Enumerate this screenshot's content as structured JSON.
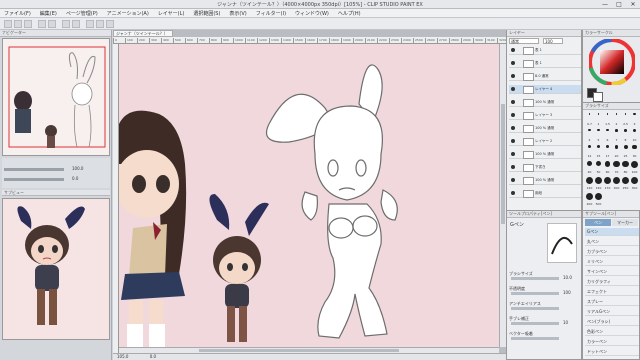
{
  "window": {
    "title": "ジャンナ（ツインテール？）（4000×4000px 350dpi）[105%] - CLIP STUDIO PAINT EX",
    "controls": [
      "—",
      "□",
      "✕"
    ]
  },
  "menu": [
    "ファイル(F)",
    "編集(E)",
    "ページ管理(P)",
    "アニメーション(A)",
    "レイヤー(L)",
    "選択範囲(S)",
    "表示(V)",
    "フィルター(I)",
    "ウィンドウ(W)",
    "ヘルプ(H)"
  ],
  "left_panel": {
    "navigator_title": "ナビゲーター",
    "subview_title": "サブビュー",
    "zoom_value": "100.0",
    "angle_value": "0.0"
  },
  "canvas": {
    "tab_label": "ジャンナ（ツインテール？）",
    "ruler_ticks": [
      "0",
      "100",
      "200",
      "300",
      "400",
      "500",
      "600",
      "700",
      "800",
      "900",
      "1000",
      "1100",
      "1200",
      "1300",
      "1400",
      "1500",
      "1600",
      "1700",
      "1800",
      "1900",
      "2000",
      "2100",
      "2200",
      "2300",
      "2400",
      "2500",
      "2600",
      "2700",
      "2800",
      "2900",
      "3000",
      "3100",
      "3200"
    ],
    "status_zoom": "105.0",
    "status_angle": "0.0"
  },
  "layer_panel": {
    "title": "レイヤー",
    "blend_mode": "通常",
    "opacity": "100",
    "layers": [
      {
        "name": "表 1"
      },
      {
        "name": "表 1"
      },
      {
        "name": "8.0 通常"
      },
      {
        "name": "レイヤー 4"
      },
      {
        "name": "100 % 通常"
      },
      {
        "name": "レイヤー 3"
      },
      {
        "name": "100 % 通常"
      },
      {
        "name": "レイヤー 2"
      },
      {
        "name": "100 % 通常"
      },
      {
        "name": "下書き"
      },
      {
        "name": "100 % 通常"
      },
      {
        "name": "用紙"
      }
    ]
  },
  "color_panel": {
    "title": "カラーサークル",
    "hue_hex": "#d22828"
  },
  "brush_panel": {
    "title": "ブラシサイズ",
    "sizes": [
      "0.7",
      "1",
      "1.5",
      "2",
      "2.5",
      "3",
      "4",
      "5",
      "6",
      "7",
      "8",
      "10",
      "12",
      "15",
      "17",
      "20",
      "25",
      "30",
      "40",
      "50",
      "60",
      "70",
      "80",
      "100",
      "120",
      "150",
      "170",
      "200",
      "250",
      "300",
      "400",
      "500"
    ]
  },
  "tool_property": {
    "title": "ツールプロパティ[ペン]",
    "tool_name": "Gペン",
    "rows": [
      {
        "label": "ブラシサイズ",
        "value": "10.0"
      },
      {
        "label": "不透明度",
        "value": "100"
      },
      {
        "label": "アンチエイリアス",
        "value": ""
      },
      {
        "label": "手ブレ補正",
        "value": "10"
      },
      {
        "label": "ベクター吸着",
        "value": ""
      }
    ]
  },
  "sub_tool": {
    "title": "サブツール[ペン]",
    "tabs": [
      "ペン",
      "マーカー"
    ],
    "items": [
      "Gペン",
      "丸ペン",
      "カブラペン",
      "ミリペン",
      "サインペン",
      "カリグラフィ",
      "エフェクト",
      "スプレー",
      "リアルGペン",
      "ペン(ブラシ)",
      "色彩ペン",
      "カラーペン",
      "ドットペン"
    ]
  }
}
